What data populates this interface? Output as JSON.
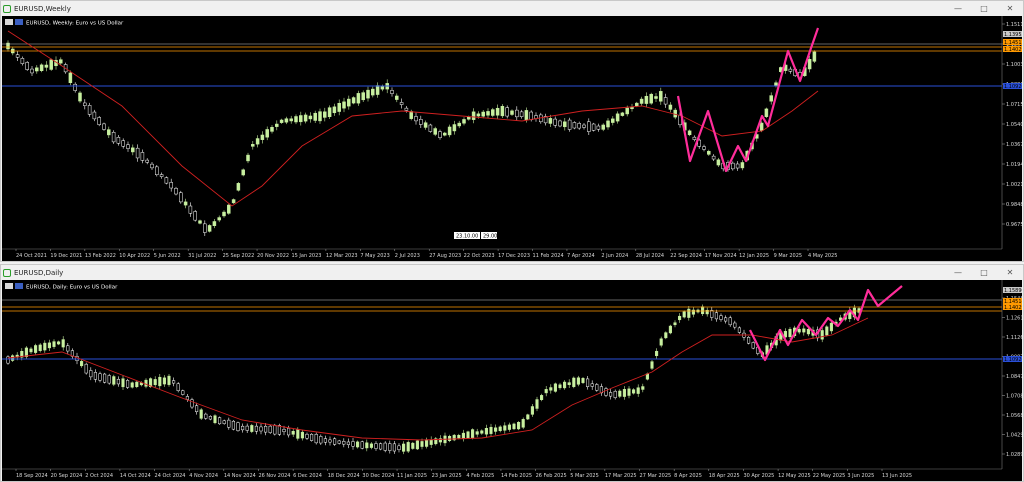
{
  "colors": {
    "bull": "#c8f0a0",
    "bear": "#ffffff",
    "ma": "#d02020",
    "zig": "#ff2d9a",
    "orange": "#ff9900",
    "blue": "#2a4fd8",
    "bg": "#000000",
    "grid": "#555555"
  },
  "windows": [
    {
      "title": "EURUSD,Weekly",
      "header": "EURUSD, Weekly:  Euro vs US Dollar",
      "price_labels": [
        "1.15110",
        "1.12570",
        "1.10030",
        "1.08860",
        "1.07150",
        "1.05400",
        "1.03670",
        "1.01940",
        "1.00210",
        "0.98480",
        "0.96750"
      ],
      "highlight_prices": [
        {
          "text": "1.13955",
          "color": "#c9c9c9"
        },
        {
          "text": "1.14512",
          "color": "#ff9900"
        },
        {
          "text": "1.14029",
          "color": "#ff9900"
        },
        {
          "text": "1.10920",
          "color": "#2a4fd8"
        }
      ],
      "date_labels": [
        "24 Oct 2021",
        "19 Dec 2021",
        "13 Feb 2022",
        "10 Apr 2022",
        "5 Jun 2022",
        "31 Jul 2022",
        "25 Sep 2022",
        "20 Nov 2022",
        "15 Jan 2023",
        "12 Mar 2023",
        "7 May 2023",
        "2 Jul 2023",
        "27 Aug 2023",
        "22 Oct 2023",
        "17 Dec 2023",
        "11 Feb 2024",
        "7 Apr 2024",
        "2 Jun 2024",
        "28 Jul 2024",
        "22 Sep 2024",
        "17 Nov 2024",
        "12 Jan 2025",
        "9 Mar 2025",
        "4 May 2025"
      ],
      "time_badge": [
        "23.10.00",
        "29.00"
      ]
    },
    {
      "title": "EURUSD,Daily",
      "header": "EURUSD, Daily:  Euro vs US Dollar",
      "price_labels": [
        "1.15480",
        "1.12610",
        "1.11265",
        "1.09870",
        "1.08475",
        "1.07080",
        "1.05685",
        "1.04290",
        "1.02895"
      ],
      "highlight_prices": [
        {
          "text": "1.15890",
          "color": "#c9c9c9"
        },
        {
          "text": "1.14514",
          "color": "#ff9900"
        },
        {
          "text": "1.14029",
          "color": "#ff9900"
        },
        {
          "text": "1.10920",
          "color": "#2a4fd8"
        }
      ],
      "date_labels": [
        "18 Sep 2024",
        "20 Sep 2024",
        "2 Oct 2024",
        "14 Oct 2024",
        "24 Oct 2024",
        "4 Nov 2024",
        "14 Nov 2024",
        "26 Nov 2024",
        "6 Dec 2024",
        "18 Dec 2024",
        "30 Dec 2024",
        "11 Jan 2025",
        "23 Jan 2025",
        "4 Feb 2025",
        "14 Feb 2025",
        "26 Feb 2025",
        "5 Mar 2025",
        "17 Mar 2025",
        "27 Mar 2025",
        "8 Apr 2025",
        "18 Apr 2025",
        "30 Apr 2025",
        "12 May 2025",
        "22 May 2025",
        "3 Jun 2025",
        "13 Jun 2025"
      ]
    }
  ]
}
